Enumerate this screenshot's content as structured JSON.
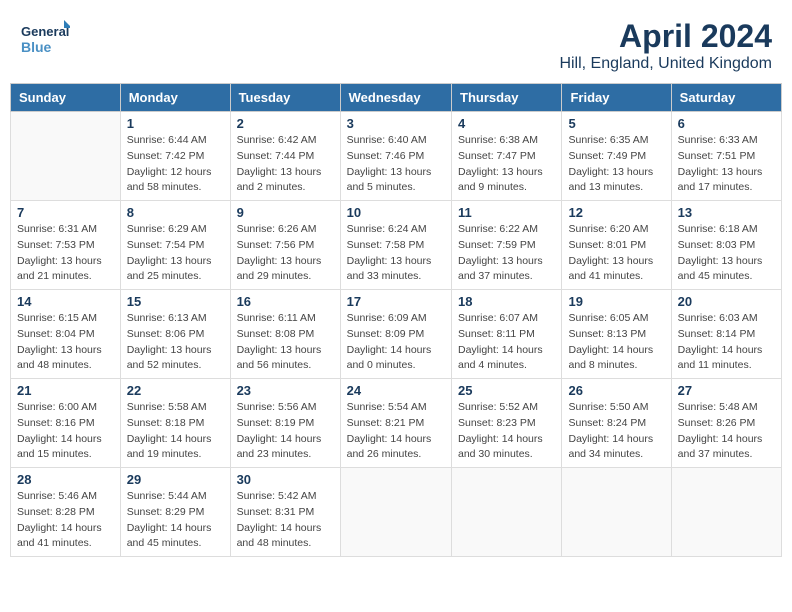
{
  "header": {
    "logo_line1": "General",
    "logo_line2": "Blue",
    "title": "April 2024",
    "subtitle": "Hill, England, United Kingdom"
  },
  "calendar": {
    "days_of_week": [
      "Sunday",
      "Monday",
      "Tuesday",
      "Wednesday",
      "Thursday",
      "Friday",
      "Saturday"
    ],
    "weeks": [
      [
        {
          "day": "",
          "info": ""
        },
        {
          "day": "1",
          "info": "Sunrise: 6:44 AM\nSunset: 7:42 PM\nDaylight: 12 hours\nand 58 minutes."
        },
        {
          "day": "2",
          "info": "Sunrise: 6:42 AM\nSunset: 7:44 PM\nDaylight: 13 hours\nand 2 minutes."
        },
        {
          "day": "3",
          "info": "Sunrise: 6:40 AM\nSunset: 7:46 PM\nDaylight: 13 hours\nand 5 minutes."
        },
        {
          "day": "4",
          "info": "Sunrise: 6:38 AM\nSunset: 7:47 PM\nDaylight: 13 hours\nand 9 minutes."
        },
        {
          "day": "5",
          "info": "Sunrise: 6:35 AM\nSunset: 7:49 PM\nDaylight: 13 hours\nand 13 minutes."
        },
        {
          "day": "6",
          "info": "Sunrise: 6:33 AM\nSunset: 7:51 PM\nDaylight: 13 hours\nand 17 minutes."
        }
      ],
      [
        {
          "day": "7",
          "info": "Sunrise: 6:31 AM\nSunset: 7:53 PM\nDaylight: 13 hours\nand 21 minutes."
        },
        {
          "day": "8",
          "info": "Sunrise: 6:29 AM\nSunset: 7:54 PM\nDaylight: 13 hours\nand 25 minutes."
        },
        {
          "day": "9",
          "info": "Sunrise: 6:26 AM\nSunset: 7:56 PM\nDaylight: 13 hours\nand 29 minutes."
        },
        {
          "day": "10",
          "info": "Sunrise: 6:24 AM\nSunset: 7:58 PM\nDaylight: 13 hours\nand 33 minutes."
        },
        {
          "day": "11",
          "info": "Sunrise: 6:22 AM\nSunset: 7:59 PM\nDaylight: 13 hours\nand 37 minutes."
        },
        {
          "day": "12",
          "info": "Sunrise: 6:20 AM\nSunset: 8:01 PM\nDaylight: 13 hours\nand 41 minutes."
        },
        {
          "day": "13",
          "info": "Sunrise: 6:18 AM\nSunset: 8:03 PM\nDaylight: 13 hours\nand 45 minutes."
        }
      ],
      [
        {
          "day": "14",
          "info": "Sunrise: 6:15 AM\nSunset: 8:04 PM\nDaylight: 13 hours\nand 48 minutes."
        },
        {
          "day": "15",
          "info": "Sunrise: 6:13 AM\nSunset: 8:06 PM\nDaylight: 13 hours\nand 52 minutes."
        },
        {
          "day": "16",
          "info": "Sunrise: 6:11 AM\nSunset: 8:08 PM\nDaylight: 13 hours\nand 56 minutes."
        },
        {
          "day": "17",
          "info": "Sunrise: 6:09 AM\nSunset: 8:09 PM\nDaylight: 14 hours\nand 0 minutes."
        },
        {
          "day": "18",
          "info": "Sunrise: 6:07 AM\nSunset: 8:11 PM\nDaylight: 14 hours\nand 4 minutes."
        },
        {
          "day": "19",
          "info": "Sunrise: 6:05 AM\nSunset: 8:13 PM\nDaylight: 14 hours\nand 8 minutes."
        },
        {
          "day": "20",
          "info": "Sunrise: 6:03 AM\nSunset: 8:14 PM\nDaylight: 14 hours\nand 11 minutes."
        }
      ],
      [
        {
          "day": "21",
          "info": "Sunrise: 6:00 AM\nSunset: 8:16 PM\nDaylight: 14 hours\nand 15 minutes."
        },
        {
          "day": "22",
          "info": "Sunrise: 5:58 AM\nSunset: 8:18 PM\nDaylight: 14 hours\nand 19 minutes."
        },
        {
          "day": "23",
          "info": "Sunrise: 5:56 AM\nSunset: 8:19 PM\nDaylight: 14 hours\nand 23 minutes."
        },
        {
          "day": "24",
          "info": "Sunrise: 5:54 AM\nSunset: 8:21 PM\nDaylight: 14 hours\nand 26 minutes."
        },
        {
          "day": "25",
          "info": "Sunrise: 5:52 AM\nSunset: 8:23 PM\nDaylight: 14 hours\nand 30 minutes."
        },
        {
          "day": "26",
          "info": "Sunrise: 5:50 AM\nSunset: 8:24 PM\nDaylight: 14 hours\nand 34 minutes."
        },
        {
          "day": "27",
          "info": "Sunrise: 5:48 AM\nSunset: 8:26 PM\nDaylight: 14 hours\nand 37 minutes."
        }
      ],
      [
        {
          "day": "28",
          "info": "Sunrise: 5:46 AM\nSunset: 8:28 PM\nDaylight: 14 hours\nand 41 minutes."
        },
        {
          "day": "29",
          "info": "Sunrise: 5:44 AM\nSunset: 8:29 PM\nDaylight: 14 hours\nand 45 minutes."
        },
        {
          "day": "30",
          "info": "Sunrise: 5:42 AM\nSunset: 8:31 PM\nDaylight: 14 hours\nand 48 minutes."
        },
        {
          "day": "",
          "info": ""
        },
        {
          "day": "",
          "info": ""
        },
        {
          "day": "",
          "info": ""
        },
        {
          "day": "",
          "info": ""
        }
      ]
    ]
  }
}
